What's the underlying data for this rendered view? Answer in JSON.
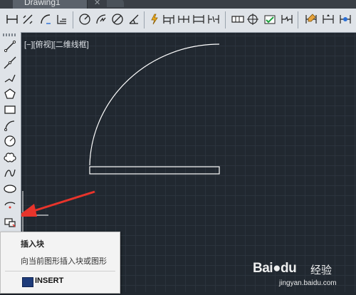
{
  "document_tab": {
    "title": "Drawing1"
  },
  "viewport": {
    "label": "[−][俯视][二维线框]"
  },
  "tooltip": {
    "title": "插入块",
    "description": "向当前图形插入块或图形",
    "command": "INSERT"
  },
  "watermark": {
    "logo": "Bai●du",
    "text": "经验",
    "url": "jingyan.baidu.com"
  },
  "toolbar_icons": [
    "dimension-linear-icon",
    "dimension-aligned-icon",
    "dimension-arc-icon",
    "dimension-ordinate-icon",
    "dimension-radius-icon",
    "dimension-jogged-icon",
    "dimension-diameter-icon",
    "dimension-angular-icon",
    "quick-dimension-icon",
    "baseline-dimension-icon",
    "continue-dimension-icon",
    "dimension-space-icon",
    "dimension-break-icon",
    "tolerance-icon",
    "center-mark-icon",
    "inspection-icon",
    "jogged-linear-icon",
    "dimension-edit-icon"
  ],
  "palette_icons": [
    "line-icon",
    "construction-line-icon",
    "polyline-icon",
    "polygon-icon",
    "rectangle-icon",
    "arc-icon",
    "circle-icon",
    "revision-cloud-icon",
    "spline-icon",
    "ellipse-icon",
    "ellipse-arc-icon",
    "insert-block-icon",
    "make-block-icon",
    "point-icon",
    "hatch-icon",
    "gradient-icon"
  ],
  "colors": {
    "accent_arrow": "#e8342b",
    "viewport_bg": "#212830",
    "geometry": "#ffffff"
  }
}
